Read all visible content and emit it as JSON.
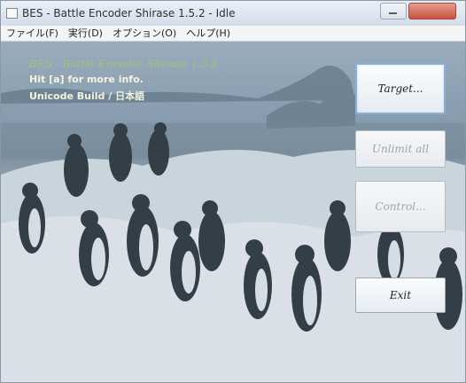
{
  "window": {
    "title": "BES - Battle Encoder Shirase 1.5.2 - Idle"
  },
  "menu": [
    {
      "label": "ファイル(F)"
    },
    {
      "label": "実行(D)"
    },
    {
      "label": "オプション(O)"
    },
    {
      "label": "ヘルプ(H)"
    }
  ],
  "info": {
    "app_name": "BES - Battle Encoder Shirase 1.5.2",
    "help_hint": "Hit [a] for more info.",
    "build": "Unicode Build / 日本語"
  },
  "buttons": {
    "target": {
      "label": "Target...",
      "enabled": true,
      "default": true
    },
    "unlimit_all": {
      "label": "Unlimit all",
      "enabled": false
    },
    "control": {
      "label": "Control...",
      "enabled": false
    },
    "exit": {
      "label": "Exit",
      "enabled": true
    }
  },
  "colors": {
    "app_name_text": "#9ec27a",
    "info_text": "#f5f3dd",
    "close_button": "#c9513f",
    "default_button_border": "#86b0d8"
  }
}
